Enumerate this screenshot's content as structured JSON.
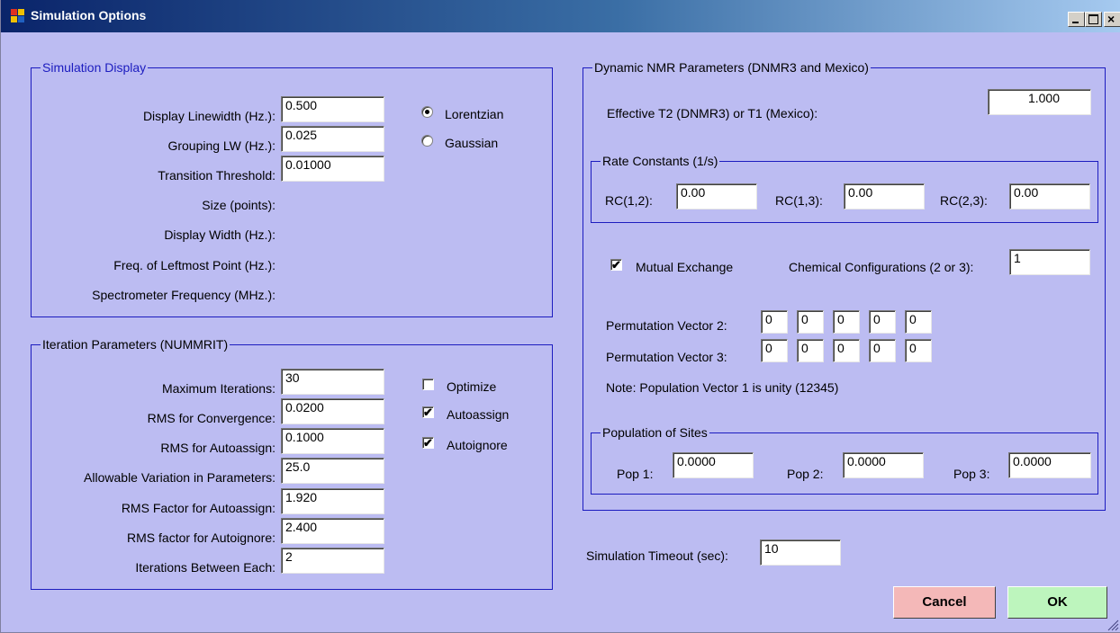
{
  "window": {
    "title": "Simulation Options"
  },
  "simulation_display": {
    "title": "Simulation Display",
    "display_linewidth": {
      "label": "Display Linewidth (Hz.):",
      "value": "0.500"
    },
    "grouping_lw": {
      "label": "Grouping LW (Hz.):",
      "value": "0.025"
    },
    "transition_threshold": {
      "label": "Transition Threshold:",
      "value": "0.01000"
    },
    "size_points": {
      "label": "Size (points):"
    },
    "display_width": {
      "label": "Display Width (Hz.):"
    },
    "freq_leftmost": {
      "label": "Freq. of Leftmost Point (Hz.):"
    },
    "spectrometer_freq": {
      "label": "Spectrometer Frequency (MHz.):"
    },
    "lorentzian": {
      "label": "Lorentzian",
      "selected": true
    },
    "gaussian": {
      "label": "Gaussian",
      "selected": false
    }
  },
  "iteration": {
    "title": "Iteration Parameters (NUMMRIT)",
    "max_iterations": {
      "label": "Maximum Iterations:",
      "value": "30"
    },
    "rms_convergence": {
      "label": "RMS for Convergence:",
      "value": "0.0200"
    },
    "rms_autoassign": {
      "label": "RMS for Autoassign:",
      "value": "0.1000"
    },
    "allowable_variation": {
      "label": "Allowable Variation in Parameters:",
      "value": "25.0"
    },
    "rms_factor_autoassign": {
      "label": "RMS Factor for Autoassign:",
      "value": "1.920"
    },
    "rms_factor_autoignore": {
      "label": "RMS factor for Autoignore:",
      "value": "2.400"
    },
    "iterations_between": {
      "label": "Iterations Between Each:",
      "value": "2"
    },
    "optimize": {
      "label": "Optimize",
      "checked": false
    },
    "autoassign": {
      "label": "Autoassign",
      "checked": true
    },
    "autoignore": {
      "label": "Autoignore",
      "checked": true
    }
  },
  "dnmr": {
    "title": "Dynamic NMR Parameters (DNMR3 and Mexico)",
    "effective_t2": {
      "label": "Effective T2 (DNMR3) or T1 (Mexico):",
      "value": "1.000"
    },
    "rate_constants": {
      "title": "Rate Constants (1/s)",
      "rc12": {
        "label": "RC(1,2):",
        "value": "0.00"
      },
      "rc13": {
        "label": "RC(1,3):",
        "value": "0.00"
      },
      "rc23": {
        "label": "RC(2,3):",
        "value": "0.00"
      }
    },
    "mutual_exchange": {
      "label": "Mutual Exchange",
      "checked": true
    },
    "chem_configs": {
      "label": "Chemical Configurations (2 or 3):",
      "value": "1"
    },
    "perm_vector_2": {
      "label": "Permutation Vector 2:",
      "values": [
        "0",
        "0",
        "0",
        "0",
        "0"
      ]
    },
    "perm_vector_3": {
      "label": "Permutation Vector 3:",
      "values": [
        "0",
        "0",
        "0",
        "0",
        "0"
      ]
    },
    "note": "Note: Population Vector 1 is unity (12345)",
    "population": {
      "title": "Population of Sites",
      "pop1": {
        "label": "Pop 1:",
        "value": "0.0000"
      },
      "pop2": {
        "label": "Pop 2:",
        "value": "0.0000"
      },
      "pop3": {
        "label": "Pop 3:",
        "value": "0.0000"
      }
    }
  },
  "timeout": {
    "label": "Simulation Timeout (sec):",
    "value": "10"
  },
  "buttons": {
    "cancel": "Cancel",
    "ok": "OK"
  },
  "colors": {
    "background": "#bcbcf2",
    "group_border": "#1c1cbf",
    "cancel": "#f4b8b8",
    "ok": "#bdf5bd"
  },
  "icons": [
    "app-icon",
    "minimize-icon",
    "maximize-icon",
    "close-icon",
    "resize-grip-icon"
  ]
}
